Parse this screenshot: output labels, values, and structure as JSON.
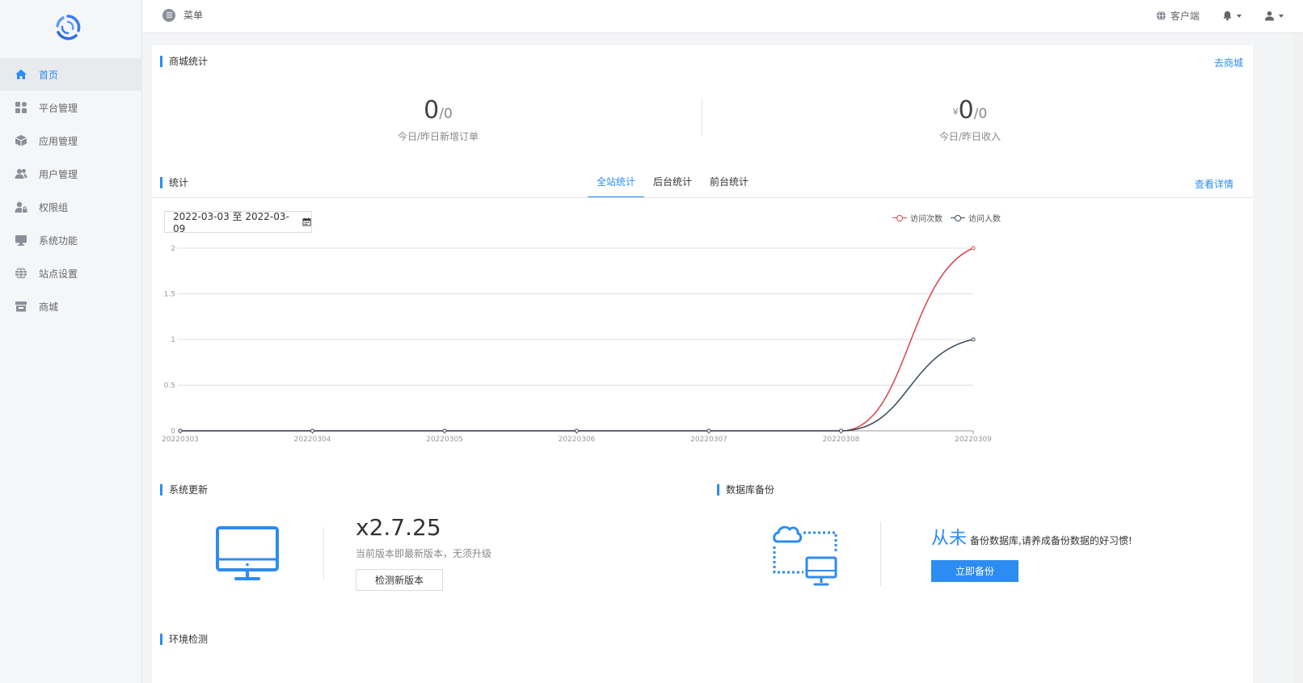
{
  "sidebar": {
    "items": [
      {
        "label": "首页",
        "icon": "home-icon",
        "active": true
      },
      {
        "label": "平台管理",
        "icon": "grid-icon",
        "active": false
      },
      {
        "label": "应用管理",
        "icon": "cube-icon",
        "active": false
      },
      {
        "label": "用户管理",
        "icon": "users-icon",
        "active": false
      },
      {
        "label": "权限组",
        "icon": "user-lock-icon",
        "active": false
      },
      {
        "label": "系统功能",
        "icon": "monitor-icon",
        "active": false
      },
      {
        "label": "站点设置",
        "icon": "globe-icon",
        "active": false
      },
      {
        "label": "商城",
        "icon": "store-icon",
        "active": false
      }
    ]
  },
  "topbar": {
    "menu_label": "菜单",
    "client_label": "客户端"
  },
  "mall_stats": {
    "title": "商城统计",
    "link": "去商城",
    "orders_today": "0",
    "orders_yesterday": "/0",
    "orders_label": "今日/昨日新增订单",
    "currency": "¥",
    "income_today": "0",
    "income_yesterday": "/0",
    "income_label": "今日/昨日收入"
  },
  "stats": {
    "title": "统计",
    "tabs": [
      "全站统计",
      "后台统计",
      "前台统计"
    ],
    "active_tab": 0,
    "detail_link": "查看详情",
    "date_range": "2022-03-03 至 2022-03-09"
  },
  "chart_data": {
    "type": "line",
    "x": [
      "20220303",
      "20220304",
      "20220305",
      "20220306",
      "20220307",
      "20220308",
      "20220309"
    ],
    "series": [
      {
        "name": "访问次数",
        "values": [
          0,
          0,
          0,
          0,
          0,
          0,
          2
        ],
        "color": "#d9454a"
      },
      {
        "name": "访问人数",
        "values": [
          0,
          0,
          0,
          0,
          0,
          0,
          1
        ],
        "color": "#3c4a5c"
      }
    ],
    "yticks": [
      "0",
      "0.5",
      "1",
      "1.5",
      "2"
    ],
    "ylim": [
      0,
      2
    ],
    "grid": true,
    "legend_position": "top-right",
    "title": "",
    "xlabel": "",
    "ylabel": ""
  },
  "system_update": {
    "title": "系统更新",
    "version": "x2.7.25",
    "note": "当前版本即最新版本，无须升级",
    "button": "检测新版本"
  },
  "db_backup": {
    "title": "数据库备份",
    "big_text": "从未",
    "text": "备份数据库,请养成备份数据的好习惯!",
    "button": "立即备份"
  },
  "env_check": {
    "title": "环境检测"
  },
  "colors": {
    "accent": "#2d8cf0",
    "series_visits": "#d9454a",
    "series_users": "#3c4a5c"
  }
}
